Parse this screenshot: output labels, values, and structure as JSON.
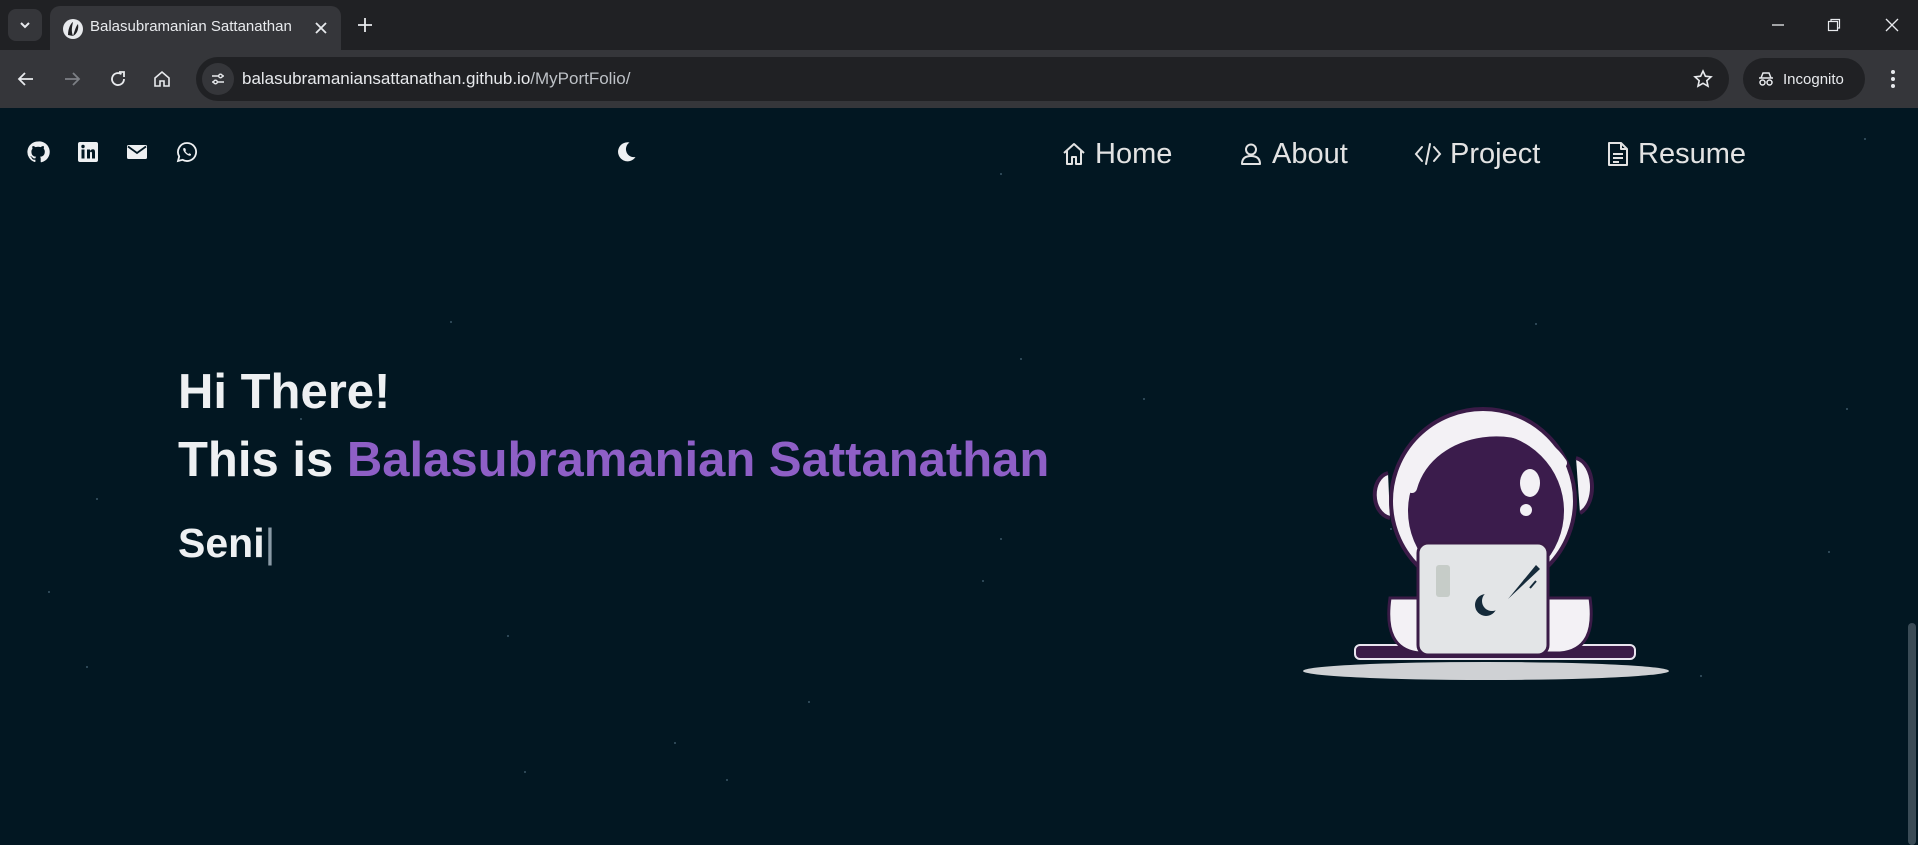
{
  "browser": {
    "tab_title": "Balasubramanian Sattanathan",
    "url_host": "balasubramaniansattanathan.github.io",
    "url_path": "/MyPortFolio/",
    "incognito_label": "Incognito"
  },
  "page": {
    "social_icons": [
      "github-icon",
      "linkedin-icon",
      "mail-icon",
      "whatsapp-icon"
    ],
    "theme_icon": "moon-icon",
    "nav": {
      "home": "Home",
      "about": "About",
      "project": "Project",
      "resume": "Resume"
    },
    "hero": {
      "greeting": "Hi There!",
      "intro_prefix": "This is ",
      "name": "Balasubramanian Sattanathan",
      "typed_text": "Seni",
      "cursor": "|"
    },
    "colors": {
      "background": "#021722",
      "accent": "#8e5fc6",
      "text": "#eef0f2"
    }
  }
}
